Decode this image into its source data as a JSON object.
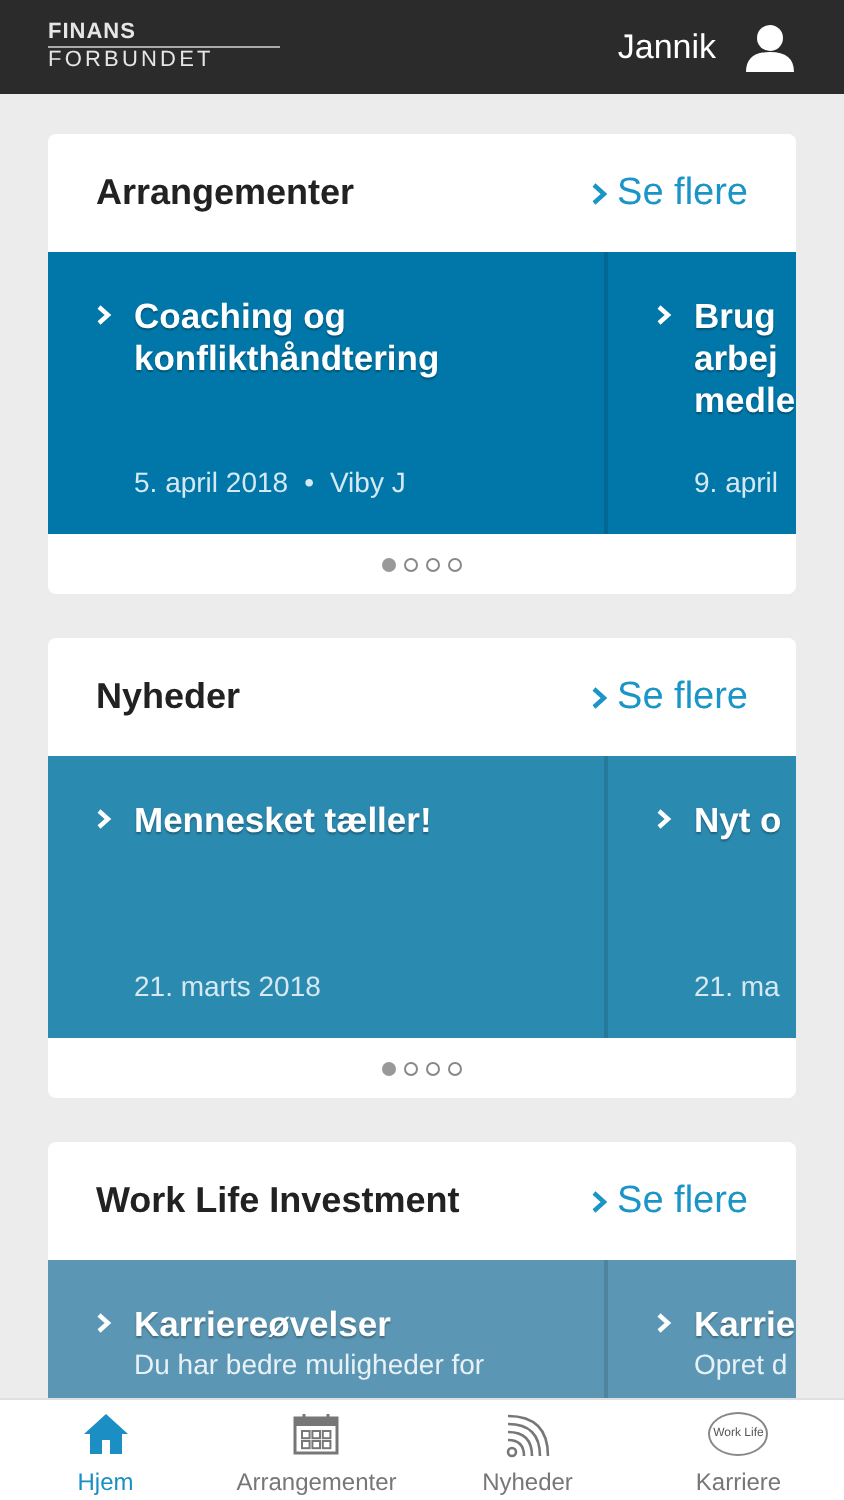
{
  "header": {
    "logo_top": "FINANS",
    "logo_bottom": "FORBUNDET",
    "user": "Jannik"
  },
  "sections": [
    {
      "title": "Arrangementer",
      "more": "Se flere",
      "color": "#0077a8",
      "slides": [
        {
          "title_lines": [
            "Coaching og",
            "konflikthåndtering"
          ],
          "meta": [
            "5. april 2018",
            "•",
            "Viby J"
          ]
        },
        {
          "title_lines": [
            "Brug",
            "arbej",
            "medle"
          ],
          "meta": [
            "9. april"
          ]
        }
      ],
      "dots": [
        {
          "selected": true
        },
        {
          "selected": false
        },
        {
          "selected": false
        },
        {
          "selected": false
        }
      ]
    },
    {
      "title": "Nyheder",
      "more": "Se flere",
      "color": "#2b8ab0",
      "slides": [
        {
          "title_lines": [
            "Mennesket tæller!"
          ],
          "meta": [
            "21. marts 2018"
          ]
        },
        {
          "title_lines": [
            "Nyt o"
          ],
          "meta": [
            "21. ma"
          ]
        }
      ],
      "dots": [
        {
          "selected": true
        },
        {
          "selected": false
        },
        {
          "selected": false
        },
        {
          "selected": false
        }
      ]
    },
    {
      "title": "Work Life Investment",
      "more": "Se flere",
      "color": "#5b97b4",
      "slides": [
        {
          "title_lines": [
            "Karriereøvelser"
          ],
          "body_lines": [
            "Du har bedre muligheder for"
          ]
        },
        {
          "title_lines": [
            "Karrie"
          ],
          "body_lines": [
            "Opret d"
          ]
        }
      ]
    }
  ],
  "tabs": [
    {
      "kind": "home",
      "label": "Hjem",
      "selected": true
    },
    {
      "kind": "calendar",
      "label": "Arrangementer",
      "selected": false
    },
    {
      "kind": "feed",
      "label": "Nyheder",
      "selected": false
    },
    {
      "kind": "badge",
      "label": "Karriere",
      "selected": false,
      "badge_text": "Work Life"
    }
  ]
}
